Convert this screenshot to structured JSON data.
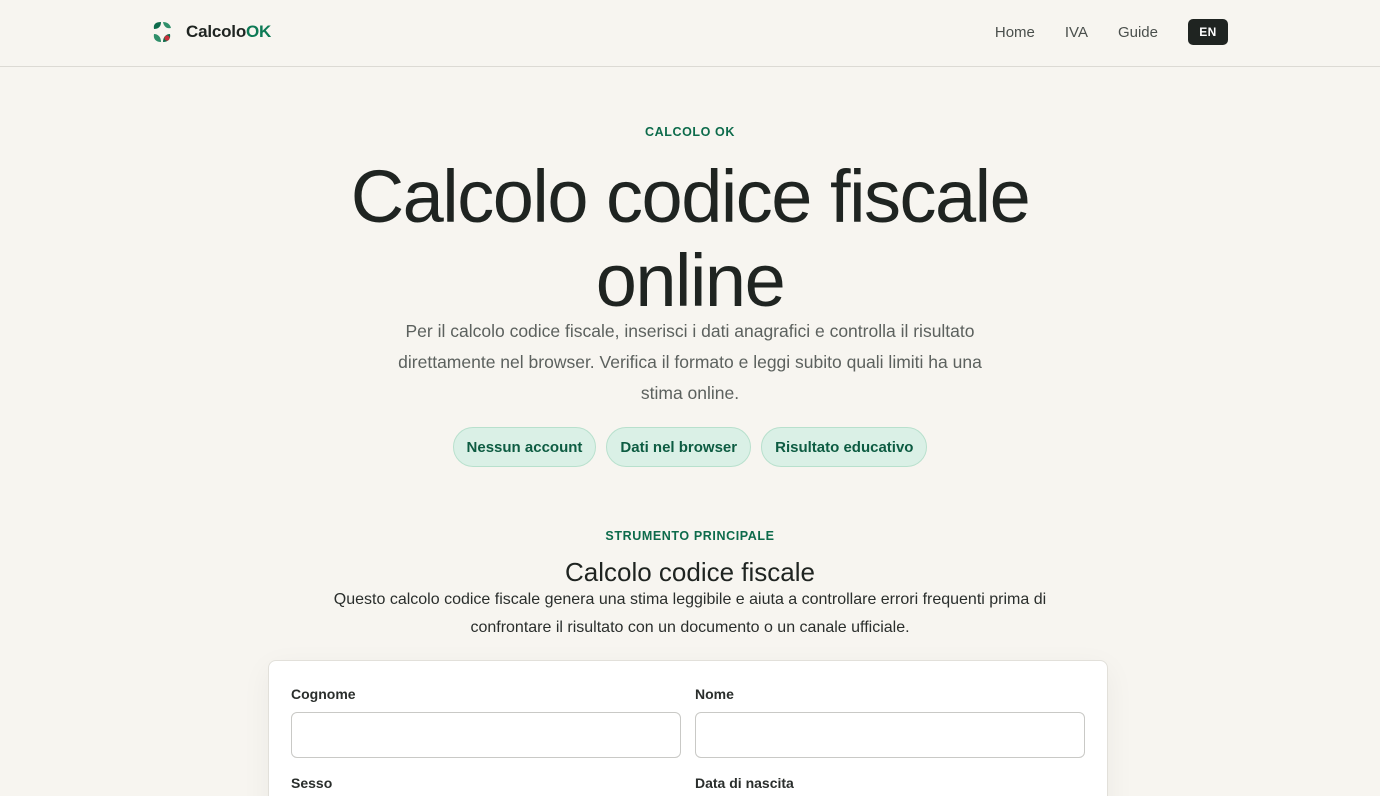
{
  "header": {
    "brand_main": "Calcolo",
    "brand_accent": "OK",
    "logo_icon": "clover-leaf-icon",
    "nav": [
      "Home",
      "IVA",
      "Guide"
    ],
    "lang_button": "EN"
  },
  "hero": {
    "eyebrow": "CALCOLO OK",
    "title": "Calcolo codice fiscale online",
    "description": "Per il calcolo codice fiscale, inserisci i dati anagrafici e controlla il risultato direttamente nel browser. Verifica il formato e leggi subito quali limiti ha una stima online.",
    "chips": [
      "Nessun account",
      "Dati nel browser",
      "Risultato educativo"
    ]
  },
  "tool": {
    "eyebrow": "STRUMENTO PRINCIPALE",
    "title": "Calcolo codice fiscale",
    "description": "Questo calcolo codice fiscale genera una stima leggibile e aiuta a controllare errori frequenti prima di confrontare il risultato con un documento o un canale ufficiale."
  },
  "form": {
    "cognome_label": "Cognome",
    "cognome_value": "",
    "nome_label": "Nome",
    "nome_value": "",
    "sesso_label": "Sesso",
    "data_nascita_label": "Data di nascita"
  },
  "colors": {
    "accent": "#0d7a55",
    "chip_bg": "#daf0e6",
    "background": "#f7f5f0",
    "dark": "#1f2421"
  }
}
